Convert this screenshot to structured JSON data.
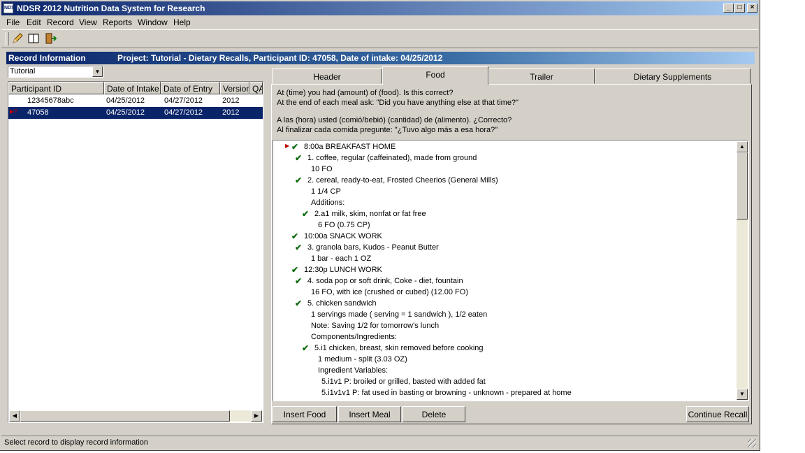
{
  "window": {
    "title": "NDSR 2012 Nutrition Data System for Research",
    "app_icon_text": "NDS",
    "controls": [
      "_",
      "□",
      "×"
    ]
  },
  "menu": [
    {
      "label": "File"
    },
    {
      "label": "Edit"
    },
    {
      "label": "Record"
    },
    {
      "label": "View"
    },
    {
      "label": "Reports"
    },
    {
      "label": "Window"
    },
    {
      "label": "Help"
    }
  ],
  "record_info": {
    "label": "Record Information",
    "project": "Project: Tutorial - Dietary Recalls, Participant ID: 47058, Date of intake: 04/25/2012"
  },
  "project_select": {
    "value": "Tutorial"
  },
  "grid": {
    "columns": [
      "Participant ID",
      "Date of Intake",
      "Date of Entry",
      "Version",
      "QA"
    ],
    "rows": [
      {
        "id": "12345678abc",
        "intake": "04/25/2012",
        "entry": "04/27/2012",
        "version": "2012",
        "selected": false
      },
      {
        "id": "47058",
        "intake": "04/25/2012",
        "entry": "04/27/2012",
        "version": "2012",
        "selected": true,
        "marker": "▶?"
      }
    ]
  },
  "tabs": [
    {
      "label": "Header"
    },
    {
      "label": "Food",
      "active": true
    },
    {
      "label": "Trailer"
    },
    {
      "label": "Dietary Supplements"
    }
  ],
  "prompts": [
    "At (time) you had (amount) of (food).  Is this correct?",
    "At the end of each meal ask: \"Did you have anything else at that time?\"",
    "A las (hora) usted (comió/bebió) (cantidad) de (alimento). ¿Correcto?",
    "Al finalizar cada comida pregunte: \"¿Tuvo algo más a esa hora?\""
  ],
  "recall_lines": [
    {
      "text": "8:00a   BREAKFAST   HOME",
      "check": true,
      "current": true
    },
    {
      "text": "1.  coffee, regular (caffeinated), made from ground",
      "check": true
    },
    {
      "text": "10 FO",
      "check": false
    },
    {
      "text": "2.  cereal, ready-to-eat, Frosted Cheerios (General Mills)",
      "check": true
    },
    {
      "text": "1 1/4 CP",
      "check": false
    },
    {
      "text": "Additions:",
      "check": false
    },
    {
      "text": "2.a1  milk, skim, nonfat or fat free",
      "check": true
    },
    {
      "text": "6 FO (0.75 CP)",
      "check": false
    },
    {
      "text": "10:00a   SNACK   WORK",
      "check": true
    },
    {
      "text": "3.  granola bars, Kudos - Peanut Butter",
      "check": true
    },
    {
      "text": "1 bar - each 1 OZ",
      "check": false
    },
    {
      "text": "12:30p   LUNCH   WORK",
      "check": true
    },
    {
      "text": "4.  soda pop or soft drink, Coke - diet, fountain",
      "check": true
    },
    {
      "text": "16 FO, with ice (crushed or cubed) (12.00 FO)",
      "check": false
    },
    {
      "text": "5.  chicken sandwich",
      "check": true
    },
    {
      "text": "1 servings made ( serving = 1 sandwich ), 1/2 eaten",
      "check": false
    },
    {
      "text": "Note: Saving 1/2 for tomorrow's lunch",
      "check": false
    },
    {
      "text": "Components/Ingredients:",
      "check": false
    },
    {
      "text": "5.i1  chicken, breast, skin removed before cooking",
      "check": true
    },
    {
      "text": "1 medium - split (3.03 OZ)",
      "check": false
    },
    {
      "text": "Ingredient Variables:",
      "check": false
    },
    {
      "text": "5.i1v1  P: broiled or grilled, basted with added fat",
      "check": false
    },
    {
      "text": "5.i1v1v1  P: fat used in basting or browning - unknown - prepared at home",
      "check": false
    }
  ],
  "buttons": {
    "insert_food": "Insert Food",
    "insert_meal": "Insert Meal",
    "delete": "Delete",
    "continue_recall": "Continue Recall"
  },
  "status": "Select record to display record information",
  "icons": {
    "check": "✔",
    "current": "▶",
    "dropdown": "▼",
    "left": "◀",
    "right": "▶",
    "up": "▲",
    "down": "▼"
  },
  "colors": {
    "selection": "#0a246a",
    "check": "#0e6b0e",
    "title_gradient_start": "#0a246a",
    "title_gradient_end": "#a6caf0"
  }
}
